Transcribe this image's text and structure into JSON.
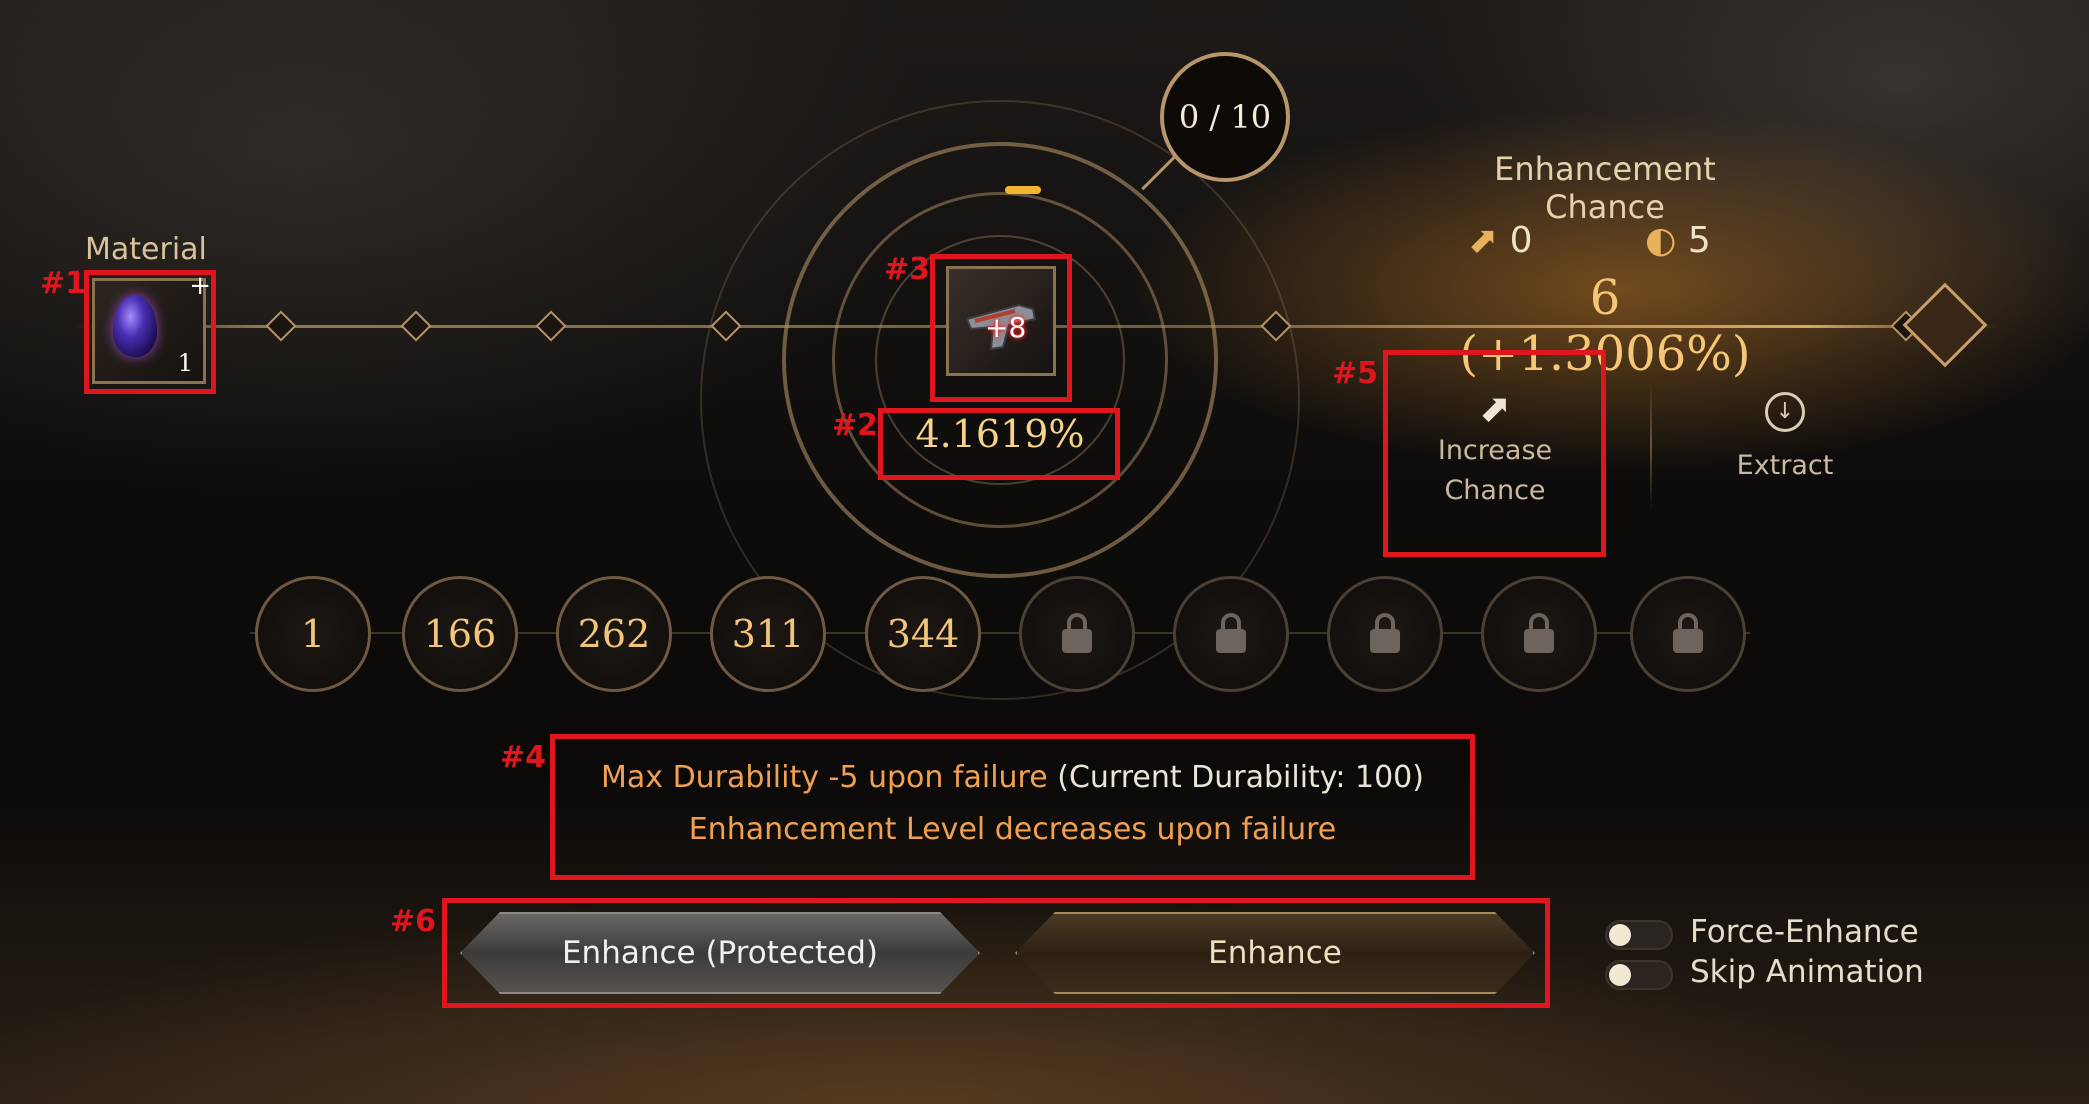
{
  "annotations": {
    "tag1": "#1",
    "tag2": "#2",
    "tag3": "#3",
    "tag4": "#4",
    "tag5": "#5",
    "tag6": "#6"
  },
  "material": {
    "label": "Material",
    "quantity": "1",
    "add_symbol": "+",
    "icon": "purple-gem-icon"
  },
  "counter": {
    "text": "0 / 10"
  },
  "item": {
    "level": "+8",
    "icon": "pistol-icon",
    "success_rate": "4.1619%"
  },
  "enhancement_chance": {
    "title": "Enhancement Chance",
    "increase_count": "0",
    "other_count": "5",
    "total": "6 (+1.3006%)"
  },
  "actions": {
    "increase_line1": "Increase",
    "increase_line2": "Chance",
    "extract": "Extract"
  },
  "levels": [
    "1",
    "166",
    "262",
    "311",
    "344"
  ],
  "locked_slots": 5,
  "warnings": {
    "durability_prefix": "Max Durability -5 upon failure",
    "durability_current": "(Current Durability: 100)",
    "level_decrease": "Enhancement Level decreases upon failure"
  },
  "buttons": {
    "protected": "Enhance (Protected)",
    "enhance": "Enhance"
  },
  "toggles": {
    "force_enhance": {
      "label": "Force-Enhance",
      "on": false
    },
    "skip_animation": {
      "label": "Skip Animation",
      "on": false
    }
  },
  "colors": {
    "annotation_red": "#e0161e",
    "gold": "#f6c777",
    "warning_orange": "#f0a050"
  }
}
